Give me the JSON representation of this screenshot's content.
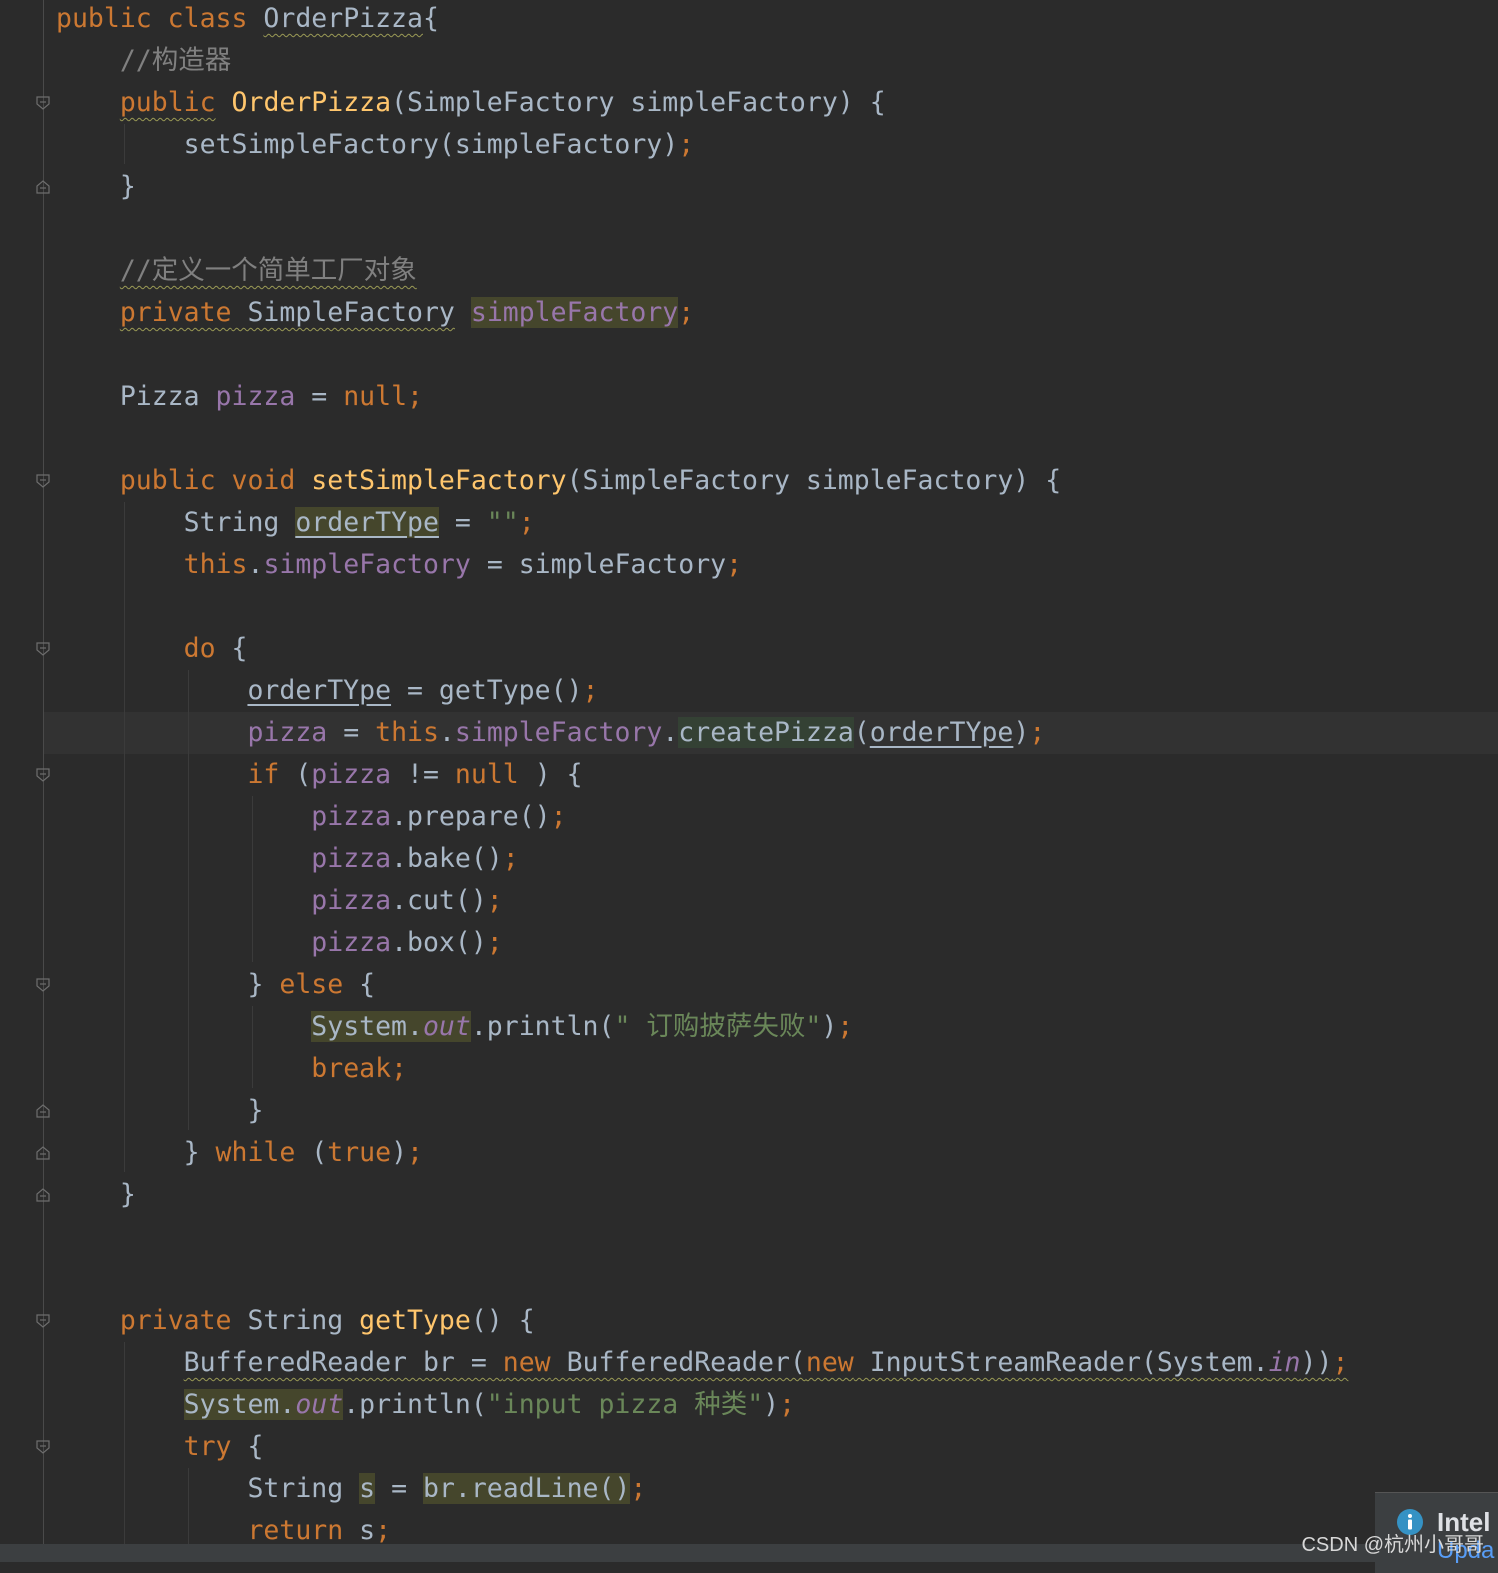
{
  "editor": {
    "lines": [
      [
        [
          "kw",
          "public class "
        ],
        [
          "wave",
          "OrderPizza"
        ],
        [
          "",
          "{"
        ]
      ],
      [
        [
          "cmt",
          "    //构造器"
        ]
      ],
      [
        [
          "",
          "    "
        ],
        [
          "kw wave",
          "public"
        ],
        [
          "kw",
          " "
        ],
        [
          "fn",
          "OrderPizza"
        ],
        [
          "",
          "(SimpleFactory simpleFactory) {"
        ]
      ],
      [
        [
          "",
          "        setSimpleFactory(simpleFactory)"
        ],
        [
          "kw",
          ";"
        ]
      ],
      [
        [
          "",
          "    }"
        ]
      ],
      [],
      [
        [
          "",
          "    "
        ],
        [
          "cmt wave",
          "//定义一个简单工厂对象"
        ]
      ],
      [
        [
          "",
          "    "
        ],
        [
          "kw wave",
          "private"
        ],
        [
          "wave",
          " SimpleFactory"
        ],
        [
          "",
          " "
        ],
        [
          "fld hl",
          "simpleFactory"
        ],
        [
          "kw",
          ";"
        ]
      ],
      [],
      [
        [
          "",
          "    Pizza "
        ],
        [
          "fld",
          "pizza"
        ],
        [
          "",
          " = "
        ],
        [
          "kw",
          "null;"
        ]
      ],
      [],
      [
        [
          "",
          "    "
        ],
        [
          "kw",
          "public void "
        ],
        [
          "fn",
          "setSimpleFactory"
        ],
        [
          "",
          "(SimpleFactory simpleFactory) {"
        ]
      ],
      [
        [
          "",
          "        String "
        ],
        [
          "hl ul",
          "orderTYpe"
        ],
        [
          "",
          " = "
        ],
        [
          "str",
          "\"\""
        ],
        [
          "kw",
          ";"
        ]
      ],
      [
        [
          "",
          "        "
        ],
        [
          "kw",
          "this"
        ],
        [
          "",
          "."
        ],
        [
          "fld",
          "simpleFactory"
        ],
        [
          "",
          " = simpleFactory"
        ],
        [
          "kw",
          ";"
        ]
      ],
      [],
      [
        [
          "",
          "        "
        ],
        [
          "kw",
          "do"
        ],
        [
          "",
          " {"
        ]
      ],
      [
        [
          "",
          "            "
        ],
        [
          "ul",
          "orderTYpe"
        ],
        [
          "",
          " = getType()"
        ],
        [
          "kw",
          ";"
        ]
      ],
      [
        [
          "",
          "            "
        ],
        [
          "fld",
          "pizza"
        ],
        [
          "",
          " = "
        ],
        [
          "kw",
          "this"
        ],
        [
          "",
          "."
        ],
        [
          "fld",
          "simpleFactory"
        ],
        [
          "",
          "."
        ],
        [
          "hl2",
          "createPizza"
        ],
        [
          "",
          "("
        ],
        [
          "ul",
          "orderTYpe"
        ],
        [
          "",
          ")"
        ],
        [
          "kw",
          ";"
        ]
      ],
      [
        [
          "",
          "            "
        ],
        [
          "kw",
          "if"
        ],
        [
          "",
          " ("
        ],
        [
          "fld",
          "pizza"
        ],
        [
          "",
          " != "
        ],
        [
          "kw",
          "null"
        ],
        [
          "",
          " ) {"
        ]
      ],
      [
        [
          "",
          "                "
        ],
        [
          "fld",
          "pizza"
        ],
        [
          "",
          ".prepare()"
        ],
        [
          "kw",
          ";"
        ]
      ],
      [
        [
          "",
          "                "
        ],
        [
          "fld",
          "pizza"
        ],
        [
          "",
          ".bake()"
        ],
        [
          "kw",
          ";"
        ]
      ],
      [
        [
          "",
          "                "
        ],
        [
          "fld",
          "pizza"
        ],
        [
          "",
          ".cut()"
        ],
        [
          "kw",
          ";"
        ]
      ],
      [
        [
          "",
          "                "
        ],
        [
          "fld",
          "pizza"
        ],
        [
          "",
          ".box()"
        ],
        [
          "kw",
          ";"
        ]
      ],
      [
        [
          "",
          "            } "
        ],
        [
          "kw",
          "else"
        ],
        [
          "",
          " {"
        ]
      ],
      [
        [
          "",
          "                "
        ],
        [
          "hl",
          "System."
        ],
        [
          "static hl",
          "out"
        ],
        [
          "",
          ".println("
        ],
        [
          "str",
          "\" 订购披萨失败\""
        ],
        [
          "",
          ")"
        ],
        [
          "kw",
          ";"
        ]
      ],
      [
        [
          "",
          "                "
        ],
        [
          "kw",
          "break;"
        ]
      ],
      [
        [
          "",
          "            }"
        ]
      ],
      [
        [
          "",
          "        } "
        ],
        [
          "kw",
          "while"
        ],
        [
          "",
          " ("
        ],
        [
          "kw",
          "true"
        ],
        [
          "",
          ")"
        ],
        [
          "kw",
          ";"
        ]
      ],
      [
        [
          "",
          "    }"
        ]
      ],
      [],
      [],
      [
        [
          "",
          "    "
        ],
        [
          "kw",
          "private "
        ],
        [
          "",
          "String "
        ],
        [
          "fn",
          "getType"
        ],
        [
          "",
          "() {"
        ]
      ],
      [
        [
          "",
          "        "
        ],
        [
          "wave",
          "BufferedReader br = "
        ],
        [
          "kw wave",
          "new"
        ],
        [
          "wave",
          " BufferedReader("
        ],
        [
          "kw wave",
          "new"
        ],
        [
          "wave",
          " InputStreamReader(System."
        ],
        [
          "static wave",
          "in"
        ],
        [
          "wave",
          "))"
        ],
        [
          "kw wave",
          ";"
        ]
      ],
      [
        [
          "",
          "        "
        ],
        [
          "hl",
          "System."
        ],
        [
          "static hl",
          "out"
        ],
        [
          "",
          ".println("
        ],
        [
          "str",
          "\"input pizza 种类\""
        ],
        [
          "",
          ")"
        ],
        [
          "kw",
          ";"
        ]
      ],
      [
        [
          "",
          "        "
        ],
        [
          "kw",
          "try"
        ],
        [
          "",
          " {"
        ]
      ],
      [
        [
          "",
          "            String "
        ],
        [
          "hl",
          "s"
        ],
        [
          "",
          " = "
        ],
        [
          "hl",
          "br.readLine()"
        ],
        [
          "kw",
          ";"
        ]
      ],
      [
        [
          "",
          "            "
        ],
        [
          "kw",
          "return"
        ],
        [
          "",
          " s"
        ],
        [
          "kw",
          ";"
        ]
      ]
    ]
  },
  "popup": {
    "title": "Intel",
    "subtitle": "Upda",
    "icon": "info-icon"
  },
  "watermark": "CSDN @杭州小哥哥",
  "colors": {
    "background": "#2b2b2b",
    "keyword": "#cc7832",
    "function": "#ffc66d",
    "field": "#9876aa",
    "comment": "#808080",
    "string": "#6a8759",
    "text": "#a9b7c6",
    "link": "#589df6"
  }
}
